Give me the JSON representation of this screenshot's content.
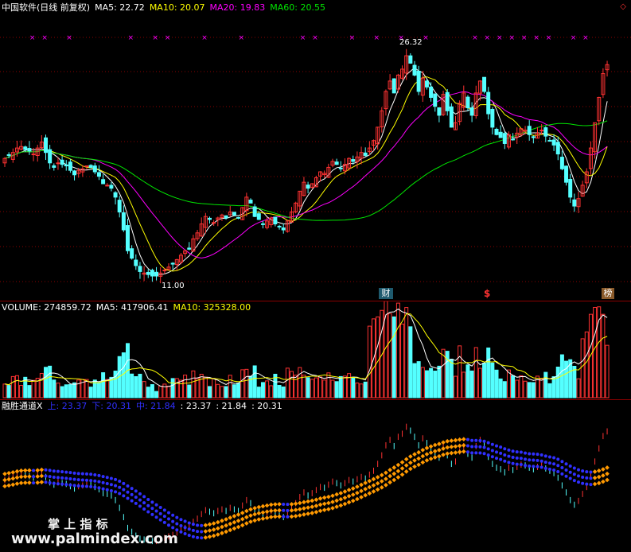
{
  "main_header": {
    "title": "中国软件(日线 前复权)",
    "ma5": "MA5: 22.72",
    "ma10": "MA10: 20.07",
    "ma20": "MA20: 19.83",
    "ma60": "MA60: 20.55"
  },
  "volume_header": {
    "title": "VOLUME: 274859.72",
    "ma5": "MA5: 417906.41",
    "ma10": "MA10: 325328.00"
  },
  "indicator_header": {
    "title": "融胜通道X",
    "up": "上: 23.37",
    "down": "下: 20.31",
    "mid": "中: 21.84",
    "v1": ": 23.37",
    "v2": ": 21.84",
    "v3": ": 20.31"
  },
  "markers": {
    "high": "26.32",
    "low": "11.00",
    "m1": "财",
    "m2": "$",
    "m3": "榜"
  },
  "watermark": {
    "line1": "掌 上 指 标",
    "line2": "www.palmindex.com"
  },
  "colors": {
    "background": "#000000",
    "up": "#ff3232",
    "down": "#54ffff",
    "ma5": "#ffffff",
    "ma10": "#ffff00",
    "ma20": "#ff00ff",
    "ma60": "#00e600",
    "channel_blue": "#3030ff",
    "channel_orange": "#ff9900",
    "frame": "#8b0000"
  },
  "chart_data": {
    "type": "candlestick",
    "closes": [
      19.2,
      19.4,
      19.6,
      19.9,
      20.0,
      19.8,
      19.7,
      19.5,
      19.9,
      20.3,
      19.6,
      18.9,
      18.6,
      18.9,
      18.8,
      18.7,
      18.4,
      18.1,
      18.4,
      18.5,
      18.7,
      18.6,
      18.3,
      18.0,
      17.5,
      17.4,
      17.2,
      16.6,
      15.6,
      14.4,
      13.0,
      12.5,
      12.0,
      11.6,
      11.5,
      11.4,
      11.3,
      11.3,
      11.5,
      11.7,
      11.9,
      12.1,
      12.4,
      12.7,
      13.0,
      13.1,
      13.8,
      14.2,
      14.8,
      15.3,
      15.1,
      14.9,
      15.2,
      15.4,
      15.2,
      15.6,
      15.4,
      15.2,
      15.9,
      16.6,
      16.2,
      15.3,
      15.1,
      14.8,
      15.0,
      15.2,
      14.8,
      14.6,
      14.4,
      15.0,
      15.6,
      16.2,
      17.0,
      17.6,
      17.2,
      17.5,
      17.9,
      18.3,
      18.2,
      18.6,
      19.0,
      18.8,
      18.5,
      18.8,
      19.2,
      19.0,
      19.3,
      19.6,
      19.4,
      19.9,
      20.4,
      21.3,
      22.4,
      23.7,
      24.4,
      23.6,
      24.8,
      25.2,
      26.1,
      25.6,
      24.8,
      23.7,
      24.6,
      24.0,
      23.3,
      22.7,
      22.1,
      23.5,
      22.4,
      21.3,
      21.6,
      22.9,
      23.6,
      22.6,
      22.1,
      23.6,
      24.4,
      23.7,
      22.2,
      21.3,
      20.8,
      20.6,
      20.2,
      20.8,
      20.5,
      20.9,
      21.2,
      21.1,
      20.8,
      20.6,
      20.9,
      21.1,
      20.7,
      20.4,
      20.1,
      19.5,
      18.5,
      17.6,
      16.6,
      16.0,
      16.5,
      17.4,
      18.3,
      19.9,
      21.6,
      23.3,
      24.9,
      25.5
    ],
    "extremes": {
      "high": 26.32,
      "low": 11.0
    },
    "volume": {
      "ma10_last": 325328.0,
      "ma5_last": 417906.41,
      "last": 274859.72
    },
    "channel": {
      "upper": 23.37,
      "middle": 21.84,
      "lower": 20.31
    }
  }
}
